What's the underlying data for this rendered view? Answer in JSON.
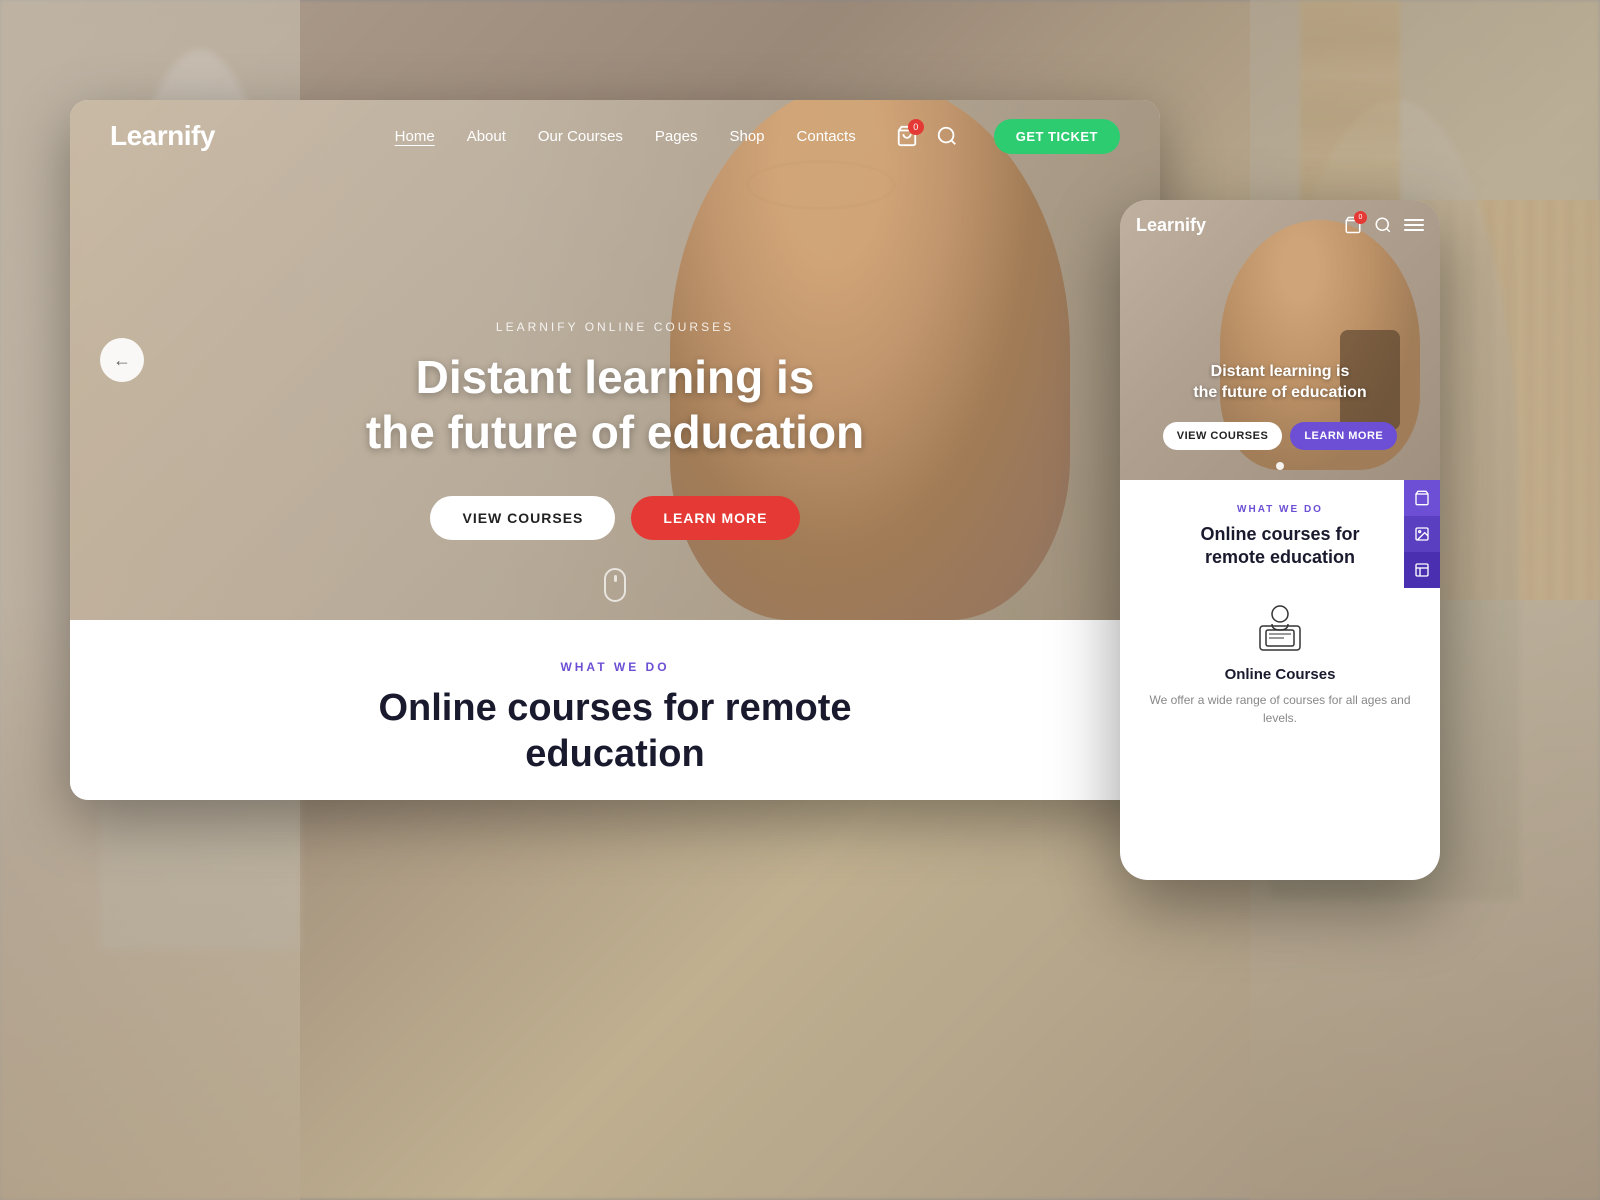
{
  "background": {
    "color": "#8a8070"
  },
  "desktop": {
    "nav": {
      "logo": "Learnify",
      "links": [
        {
          "label": "Home",
          "active": true
        },
        {
          "label": "About",
          "active": false
        },
        {
          "label": "Our Courses",
          "active": false
        },
        {
          "label": "Pages",
          "active": false
        },
        {
          "label": "Shop",
          "active": false
        },
        {
          "label": "Contacts",
          "active": false
        }
      ],
      "cart_count": "0",
      "get_ticket_label": "GET TICKET"
    },
    "hero": {
      "subtitle": "LEARNIFY ONLINE COURSES",
      "title": "Distant learning is\nthe future of education",
      "view_courses_label": "VIEW COURSES",
      "learn_more_label": "LEARN MORE"
    },
    "what_we_do": {
      "label": "WHAT WE DO",
      "title": "Online courses for remote\neducation"
    }
  },
  "mobile": {
    "nav": {
      "logo": "Learnify",
      "cart_count": "0"
    },
    "hero": {
      "title": "Distant learning is\nthe future of education",
      "view_courses_label": "VIEW COURSES",
      "learn_more_label": "LEARN MORE"
    },
    "what_we_do": {
      "label": "WHAT WE DO",
      "title": "Online courses for\nremote education",
      "course": {
        "name": "Online Courses",
        "description": "We offer a wide range of courses for all ages and levels."
      }
    }
  },
  "colors": {
    "brand_purple": "#6c4fd4",
    "brand_green": "#2ecc71",
    "brand_red": "#e53935",
    "text_dark": "#1a1a2e",
    "text_light": "#888888",
    "white": "#ffffff"
  }
}
